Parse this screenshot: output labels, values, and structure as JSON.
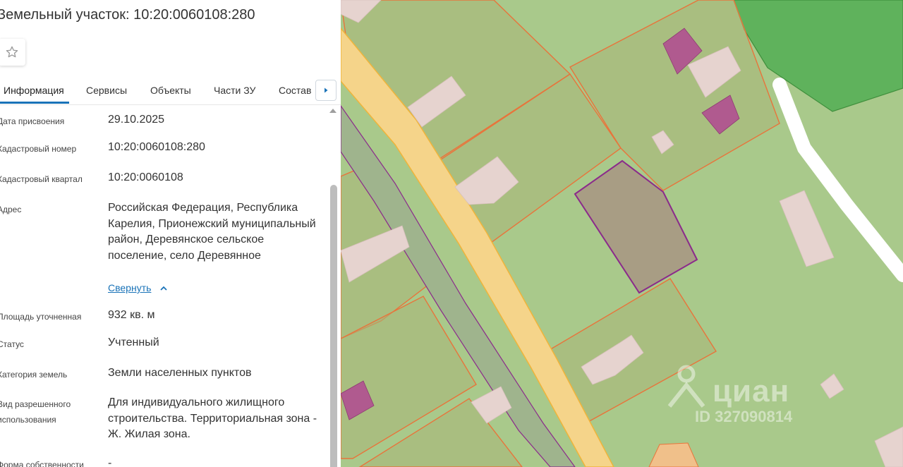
{
  "panel": {
    "title": "Земельный участок: 10:20:0060108:280",
    "tabs": [
      {
        "label": "Информация"
      },
      {
        "label": "Сервисы"
      },
      {
        "label": "Объекты"
      },
      {
        "label": "Части ЗУ"
      },
      {
        "label": "Состав"
      }
    ],
    "rows": [
      {
        "label": "Дата присвоения",
        "value": "29.10.2025"
      },
      {
        "label": "Кадастровый номер",
        "value": "10:20:0060108:280"
      },
      {
        "label": "Кадастровый квартал",
        "value": "10:20:0060108"
      },
      {
        "label": "Адрес",
        "value": "Российская Федерация, Республика Карелия, Прионежский муниципальный район, Деревянское сельское поселение, село Деревянное"
      },
      {
        "label": "Площадь уточненная",
        "value": "932 кв. м"
      },
      {
        "label": "Статус",
        "value": "Учтенный"
      },
      {
        "label": "Категория земель",
        "value": "Земли населенных пунктов"
      },
      {
        "label_line1": "Вид разрешенного",
        "label_line2": "использования",
        "value": "Для индивидуального жилищного строительства. Территориальная зона - Ж. Жилая зона."
      },
      {
        "label": "Форма собственности",
        "value": "-"
      }
    ],
    "collapse_link": "Свернуть"
  },
  "watermark": {
    "brand": "циан",
    "listing_id": "ID 327090814"
  },
  "icons": {
    "favorite": "star-outline-icon",
    "tabs_next": "caret-right-icon",
    "collapse": "chevron-up-icon",
    "scroll_up": "triangle-up-icon"
  },
  "colors": {
    "accent": "#1a73b8",
    "selected_parcel_fill": "#a89d84",
    "selected_parcel_stroke": "#8b2a8b",
    "parcel_stroke": "#e8743b",
    "building": "#b05a8f",
    "road": "#f5d48a",
    "forest": "#5fb25c"
  }
}
